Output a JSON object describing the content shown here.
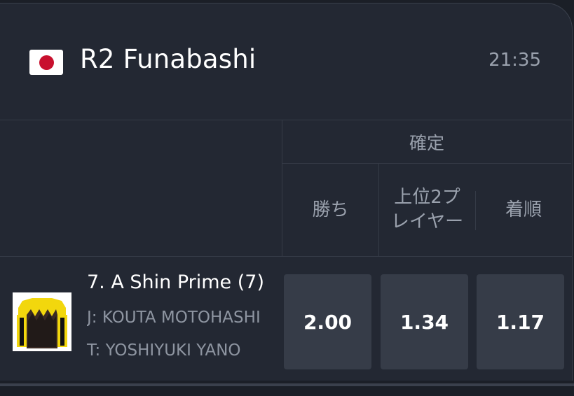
{
  "race": {
    "flag_icon": "japan-flag-icon",
    "title": "R2 Funabashi",
    "time": "21:35"
  },
  "market": {
    "group_label": "確定",
    "columns": [
      {
        "label": "勝ち"
      },
      {
        "label": "上位2プレイヤー"
      },
      {
        "label": "着順"
      }
    ]
  },
  "runner": {
    "silks_icon": "jockey-silks-icon",
    "name": "7. A Shin Prime (7)",
    "jockey": "J: KOUTA MOTOHASHI",
    "trainer": "T: YOSHIYUKI YANO",
    "odds": [
      "2.00",
      "1.34",
      "1.17"
    ]
  },
  "colors": {
    "background": "#1b1f27",
    "card": "#232833",
    "odds_button": "#363c48",
    "muted_text": "#9aa1ad"
  }
}
